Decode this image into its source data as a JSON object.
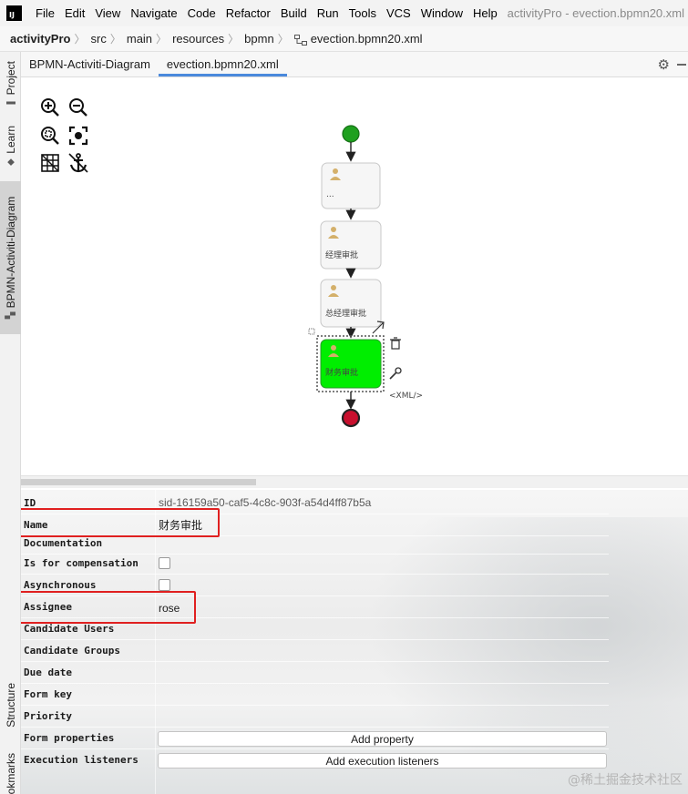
{
  "menubar": {
    "logo": "IJ",
    "items": [
      "File",
      "Edit",
      "View",
      "Navigate",
      "Code",
      "Refactor",
      "Build",
      "Run",
      "Tools",
      "VCS",
      "Window",
      "Help"
    ],
    "window_title": "activityPro - evection.bpmn20.xml"
  },
  "breadcrumb": [
    "activityPro",
    "src",
    "main",
    "resources",
    "bpmn",
    "evection.bpmn20.xml"
  ],
  "left_strip": {
    "project": "Project",
    "learn": "Learn",
    "bpmn": "BPMN-Activiti-Diagram",
    "structure": "Structure",
    "bookmarks": "okmarks"
  },
  "tabs": [
    "BPMN-Activiti-Diagram",
    "evection.bpmn20.xml"
  ],
  "icons": {
    "zoom_in": "zoom-in-icon",
    "zoom_out": "zoom-out-icon",
    "fit": "zoom-fit-icon",
    "focus": "focus-icon",
    "grid": "grid-icon",
    "anchor": "anchor-icon",
    "trash": "trash-icon",
    "wrench": "wrench-icon",
    "connect": "arrow-connect-icon",
    "gear": "gear-icon",
    "user": "user-icon"
  },
  "diagram": {
    "tasks": [
      "...",
      "经理审批",
      "总经理审批",
      "财务审批"
    ],
    "selected_task": "财务审批",
    "xml_label": "<XML/>",
    "colors": {
      "start": "#1fa01f",
      "end": "#c8102e",
      "selected": "#00ee00"
    }
  },
  "properties": {
    "labels": {
      "id": "ID",
      "name": "Name",
      "documentation": "Documentation",
      "compensation": "Is for compensation",
      "asynchronous": "Asynchronous",
      "assignee": "Assignee",
      "candidate_users": "Candidate Users",
      "candidate_groups": "Candidate Groups",
      "due_date": "Due date",
      "form_key": "Form key",
      "priority": "Priority",
      "form_properties": "Form properties",
      "execution_listeners": "Execution listeners"
    },
    "values": {
      "id": "sid-16159a50-caf5-4c8c-903f-a54d4ff87b5a",
      "name": "财务审批",
      "assignee": "rose"
    },
    "buttons": {
      "add_property": "Add property",
      "add_listeners": "Add execution listeners"
    }
  },
  "watermark": "@稀土掘金技术社区"
}
